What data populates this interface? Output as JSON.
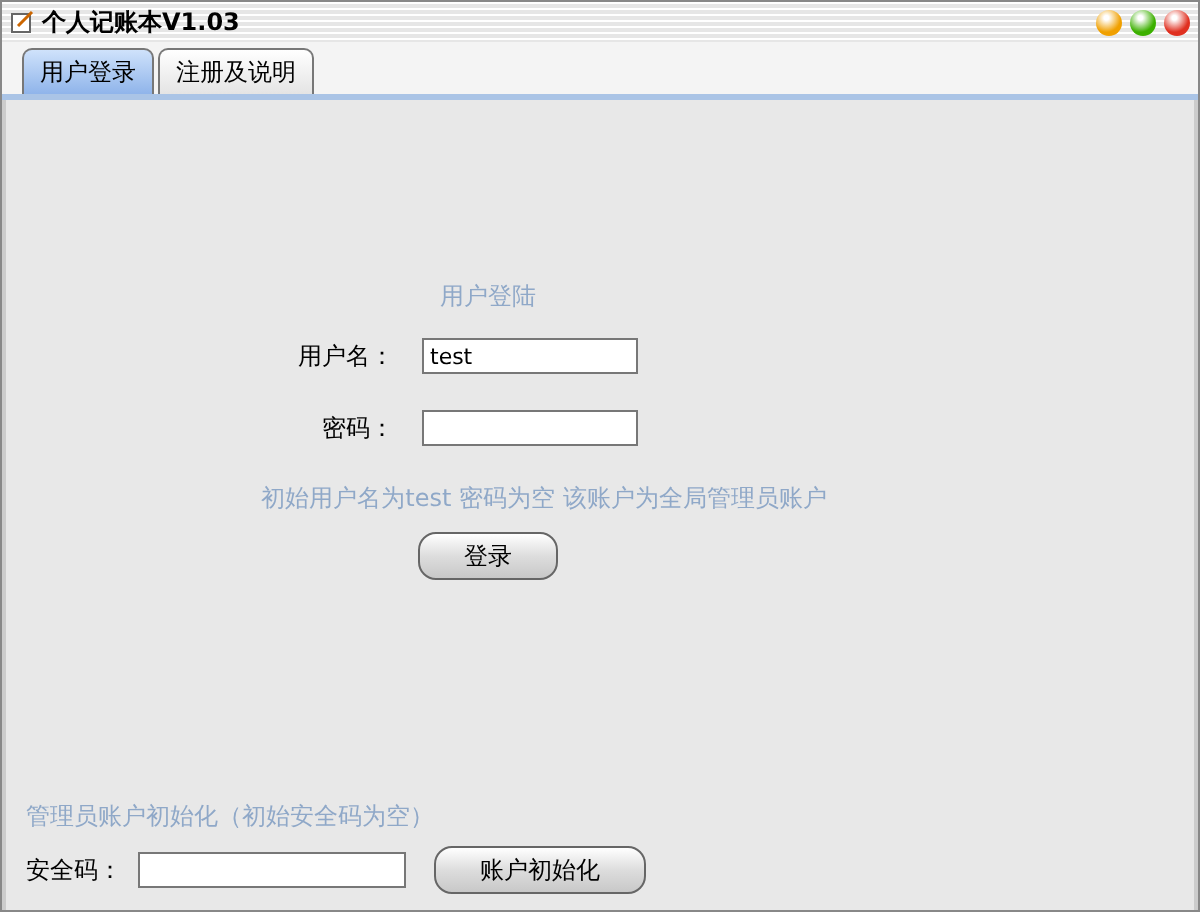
{
  "window": {
    "title": "个人记账本V1.03"
  },
  "tabs": [
    {
      "label": "用户登录",
      "selected": true
    },
    {
      "label": "注册及说明",
      "selected": false
    }
  ],
  "login": {
    "heading": "用户登陆",
    "username_label": "用户名：",
    "username_value": "test",
    "password_label": "密码：",
    "hint": "初始用户名为test 密码为空 该账户为全局管理员账户",
    "button": "登录"
  },
  "admin": {
    "heading": "管理员账户初始化（初始安全码为空）",
    "code_label": "安全码：",
    "button": "账户初始化"
  }
}
